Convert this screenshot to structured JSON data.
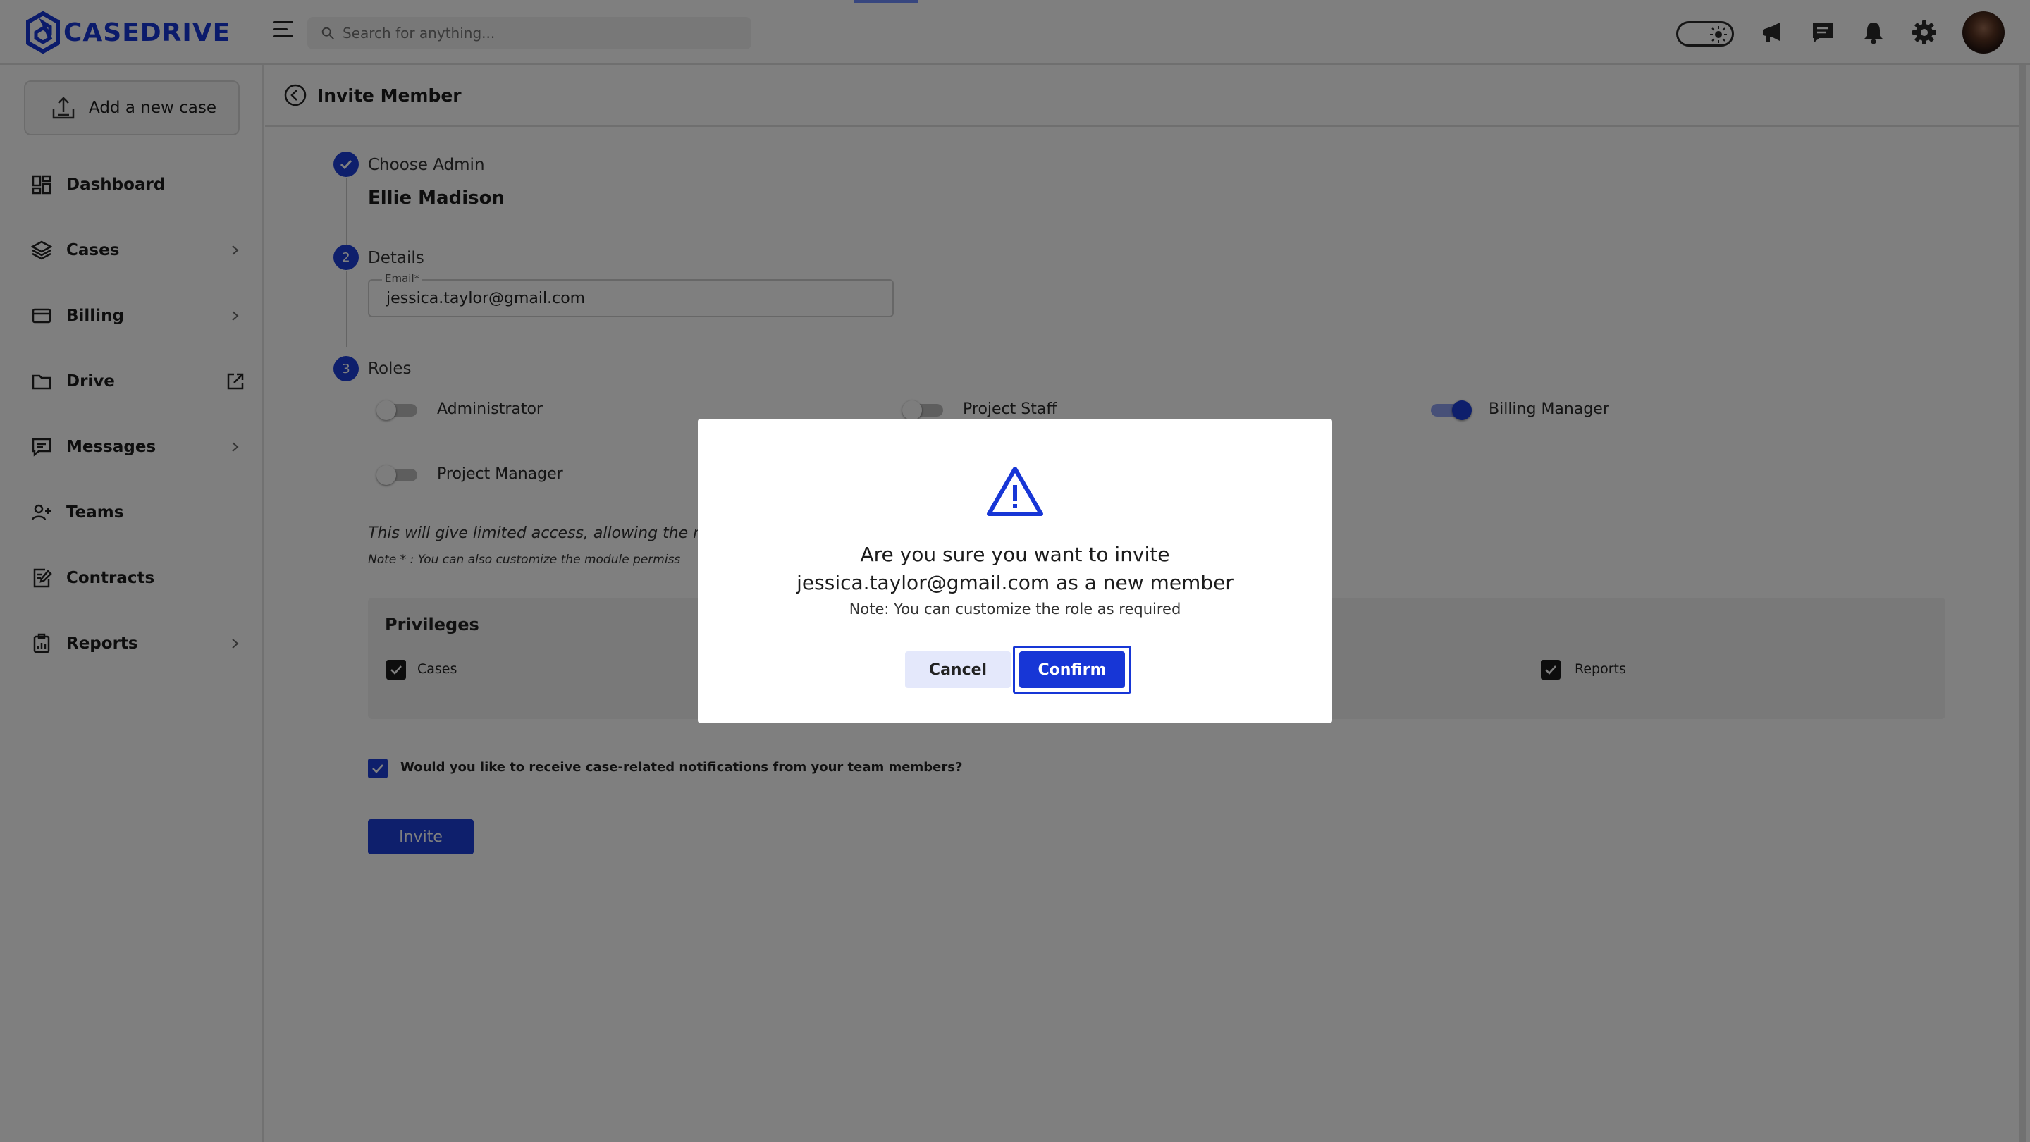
{
  "brand": {
    "name": "CASEDRIVE",
    "color": "#1736d6"
  },
  "header": {
    "search_placeholder": "Search for anything...",
    "icons": [
      "menu-icon",
      "search-icon",
      "theme-toggle-icon",
      "megaphone-icon",
      "chat-icon",
      "bell-icon",
      "gear-icon",
      "avatar"
    ]
  },
  "sidebar": {
    "add_case_label": "Add a new case",
    "items": [
      {
        "label": "Dashboard",
        "icon": "dashboard-icon"
      },
      {
        "label": "Cases",
        "icon": "layers-icon"
      },
      {
        "label": "Billing",
        "icon": "card-icon"
      },
      {
        "label": "Drive",
        "icon": "folder-icon"
      },
      {
        "label": "Messages",
        "icon": "message-icon"
      },
      {
        "label": "Teams",
        "icon": "team-icon"
      },
      {
        "label": "Contracts",
        "icon": "contract-icon"
      },
      {
        "label": "Reports",
        "icon": "report-icon"
      }
    ]
  },
  "main": {
    "title": "Invite Member",
    "steps": [
      {
        "number": "",
        "label": "Choose Admin",
        "value": "Ellie Madison"
      },
      {
        "number": "2",
        "label": "Details"
      },
      {
        "number": "3",
        "label": "Roles"
      }
    ],
    "email": {
      "label": "Email*",
      "value": "jessica.taylor@gmail.com"
    },
    "roles": [
      {
        "label": "Administrator",
        "enabled": false
      },
      {
        "label": "Project Staff",
        "enabled": false
      },
      {
        "label": "Billing Manager",
        "enabled": true
      },
      {
        "label": "Project Manager",
        "enabled": false
      }
    ],
    "role_info": "This will give limited access, allowing the me",
    "role_note": "Note * : You can also customize the module permiss",
    "privileges": {
      "title": "Privileges",
      "items": [
        {
          "label": "Cases",
          "checked": true
        },
        {
          "label": "Reports",
          "checked": true
        }
      ]
    },
    "notifications_label": "Would you like to receive case-related notifications from your team members?",
    "notifications_checked": true,
    "invite_label": "Invite"
  },
  "modal": {
    "icon": "warning-icon",
    "question_line1": "Are you sure you want to invite",
    "question_line2": "jessica.taylor@gmail.com as a new member",
    "note": "Note: You can customize the role as required",
    "cancel_label": "Cancel",
    "confirm_label": "Confirm"
  }
}
